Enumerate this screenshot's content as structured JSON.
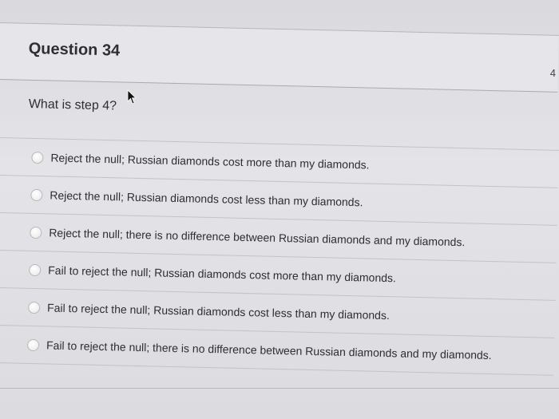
{
  "question": {
    "title": "Question 34",
    "points": "4",
    "prompt": "What is step 4?",
    "options": [
      {
        "label": "Reject the null; Russian diamonds cost more than my diamonds."
      },
      {
        "label": "Reject the null; Russian diamonds cost less than my diamonds."
      },
      {
        "label": "Reject the null; there is no difference between Russian diamonds and my diamonds."
      },
      {
        "label": "Fail to reject the null; Russian diamonds cost more than my diamonds."
      },
      {
        "label": "Fail to reject the null; Russian diamonds cost less than my diamonds."
      },
      {
        "label": "Fail to reject the null; there is no difference between Russian diamonds and my diamonds."
      }
    ]
  },
  "icons": {
    "cursor": "mouse-pointer-icon"
  }
}
